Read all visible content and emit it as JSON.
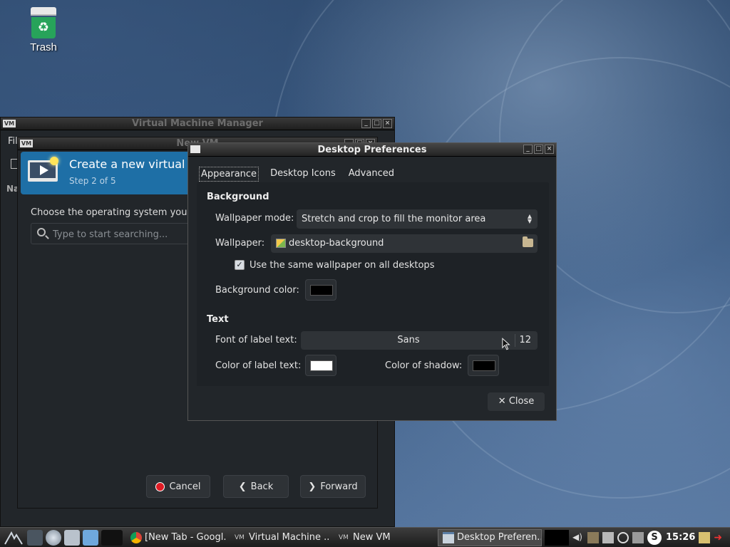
{
  "desktop": {
    "icons": [
      {
        "label": "Trash"
      }
    ]
  },
  "vmm_window": {
    "title": "Virtual Machine Manager",
    "menu_first": "Fil",
    "column_label": "Na"
  },
  "new_vm_window": {
    "title": "New VM",
    "header_title": "Create a new virtual mac",
    "step": "Step 2 of 5",
    "choose_label": "Choose the operating system you are",
    "search_placeholder": "Type to start searching...",
    "buttons": {
      "cancel": "Cancel",
      "back": "Back",
      "forward": "Forward"
    }
  },
  "prefs_window": {
    "title": "Desktop Preferences",
    "tabs": [
      "Appearance",
      "Desktop Icons",
      "Advanced"
    ],
    "background_section": "Background",
    "wallpaper_mode_label": "Wallpaper mode:",
    "wallpaper_mode_value": "Stretch and crop to fill the monitor area",
    "wallpaper_label": "Wallpaper:",
    "wallpaper_value": "desktop-background",
    "same_wallpaper_label": "Use the same wallpaper on all desktops",
    "same_wallpaper_checked": true,
    "background_color_label": "Background color:",
    "background_color": "#000000",
    "text_section": "Text",
    "font_label": "Font of label text:",
    "font_name": "Sans",
    "font_size": "12",
    "label_color_label": "Color of label text:",
    "label_color": "#ffffff",
    "shadow_color_label": "Color of shadow:",
    "shadow_color": "#000000",
    "close_label": "Close"
  },
  "taskbar": {
    "tasks": [
      {
        "label": "[New Tab - Googl...",
        "icon": "chrome-icon"
      },
      {
        "label": "Virtual Machine ...",
        "icon": "vmm-icon"
      },
      {
        "label": "New VM",
        "icon": "vmm-icon"
      },
      {
        "label": "Desktop Preferen...",
        "icon": "window-icon"
      }
    ],
    "clock": "15:26"
  }
}
